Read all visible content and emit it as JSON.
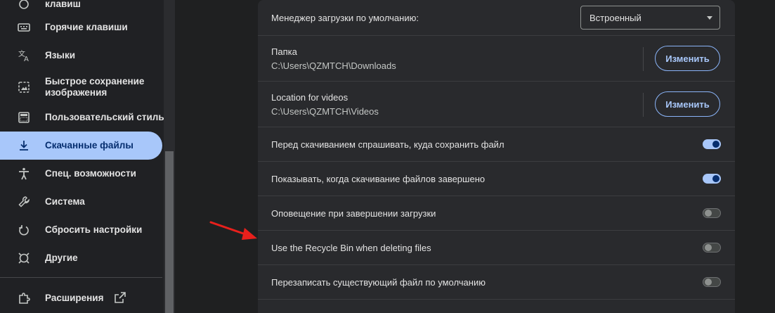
{
  "sidebar": {
    "items": [
      {
        "label": "клавиш",
        "icon": "keyboard-icon"
      },
      {
        "label": "Горячие клавиши",
        "icon": "keyboard-icon"
      },
      {
        "label": "Языки",
        "icon": "translate-icon"
      },
      {
        "label": "Быстрое сохранение изображения",
        "icon": "image-save-icon"
      },
      {
        "label": "Пользовательский стиль",
        "icon": "style-icon"
      },
      {
        "label": "Скачанные файлы",
        "icon": "download-icon",
        "active": true
      },
      {
        "label": "Спец. возможности",
        "icon": "accessibility-icon"
      },
      {
        "label": "Система",
        "icon": "wrench-icon"
      },
      {
        "label": "Сбросить настройки",
        "icon": "reset-icon"
      },
      {
        "label": "Другие",
        "icon": "other-icon"
      }
    ],
    "extensions_label": "Расширения"
  },
  "settings": {
    "download_manager": {
      "label": "Менеджер загрузки по умолчанию:",
      "selected": "Встроенный"
    },
    "folder": {
      "label": "Папка",
      "path": "C:\\Users\\QZMTCH\\Downloads",
      "button": "Изменить"
    },
    "videos": {
      "label": "Location for videos",
      "path": "C:\\Users\\QZMTCH\\Videos",
      "button": "Изменить"
    },
    "toggles": [
      {
        "label": "Перед скачиванием спрашивать, куда сохранить файл",
        "on": true
      },
      {
        "label": "Показывать, когда скачивание файлов завершено",
        "on": true
      },
      {
        "label": "Оповещение при завершении загрузки",
        "on": false
      },
      {
        "label": "Use the Recycle Bin when deleting files",
        "on": false
      },
      {
        "label": "Перезаписать существующий файл по умолчанию",
        "on": false
      }
    ]
  },
  "colors": {
    "accent": "#a8c7fa",
    "arrow": "#e8201c"
  }
}
